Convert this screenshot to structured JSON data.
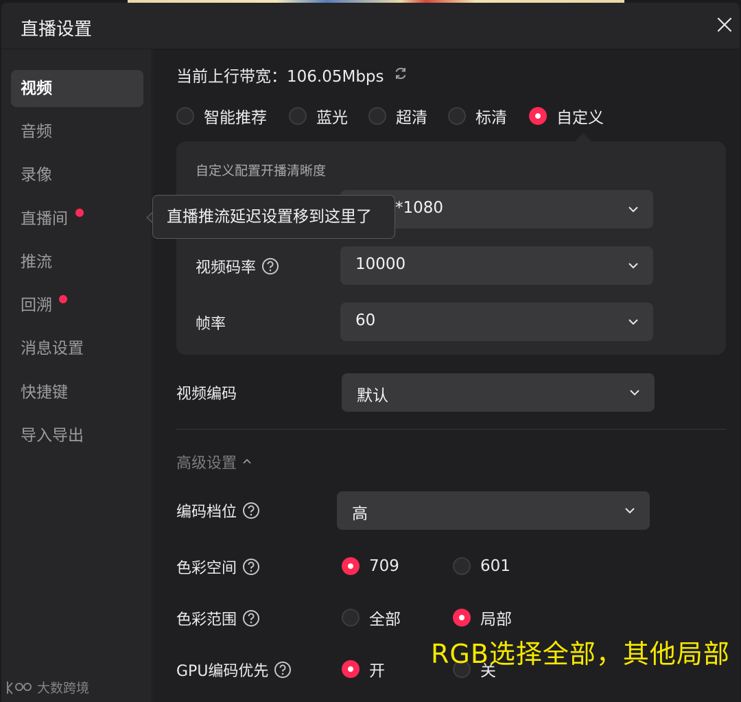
{
  "dialog": {
    "title": "直播设置",
    "close_icon": "close-icon"
  },
  "sidebar": {
    "items": [
      {
        "label": "视频",
        "active": true,
        "badge": false
      },
      {
        "label": "音频",
        "active": false,
        "badge": false
      },
      {
        "label": "录像",
        "active": false,
        "badge": false
      },
      {
        "label": "直播间",
        "active": false,
        "badge": true
      },
      {
        "label": "推流",
        "active": false,
        "badge": false
      },
      {
        "label": "回溯",
        "active": false,
        "badge": true
      },
      {
        "label": "消息设置",
        "active": false,
        "badge": false
      },
      {
        "label": "快捷键",
        "active": false,
        "badge": false
      },
      {
        "label": "导入导出",
        "active": false,
        "badge": false
      }
    ]
  },
  "video": {
    "bandwidth_label": "当前上行带宽：106.05Mbps",
    "refresh_icon": "refresh-icon",
    "quality_options": [
      {
        "label": "智能推荐",
        "selected": false
      },
      {
        "label": "蓝光",
        "selected": false
      },
      {
        "label": "超清",
        "selected": false
      },
      {
        "label": "标清",
        "selected": false
      },
      {
        "label": "自定义",
        "selected": true
      }
    ],
    "custom_panel": {
      "title": "自定义配置开播清晰度",
      "resolution_value": "*1080",
      "bitrate_label": "视频码率",
      "bitrate_value": "10000",
      "framerate_label": "帧率",
      "framerate_value": "60"
    },
    "encoder_label": "视频编码",
    "encoder_value": "默认",
    "advanced": {
      "title": "高级设置",
      "profile_label": "编码档位",
      "profile_value": "高",
      "colorspace_label": "色彩空间",
      "colorspace_options": [
        {
          "label": "709",
          "selected": true
        },
        {
          "label": "601",
          "selected": false
        }
      ],
      "colorrange_label": "色彩范围",
      "colorrange_options": [
        {
          "label": "全部",
          "selected": false
        },
        {
          "label": "局部",
          "selected": true
        }
      ],
      "gpu_label": "GPU编码优先",
      "gpu_options": [
        {
          "label": "开",
          "selected": true
        },
        {
          "label": "关",
          "selected": false
        }
      ]
    }
  },
  "tooltip": {
    "text": "直播推流延迟设置移到这里了"
  },
  "overlay_note": "RGB选择全部，其他局部",
  "watermark": "大数跨境",
  "colors": {
    "accent": "#ff2a55",
    "background": "#1f1f21",
    "panel": "#2a2a2c",
    "note": "#f6e800"
  }
}
